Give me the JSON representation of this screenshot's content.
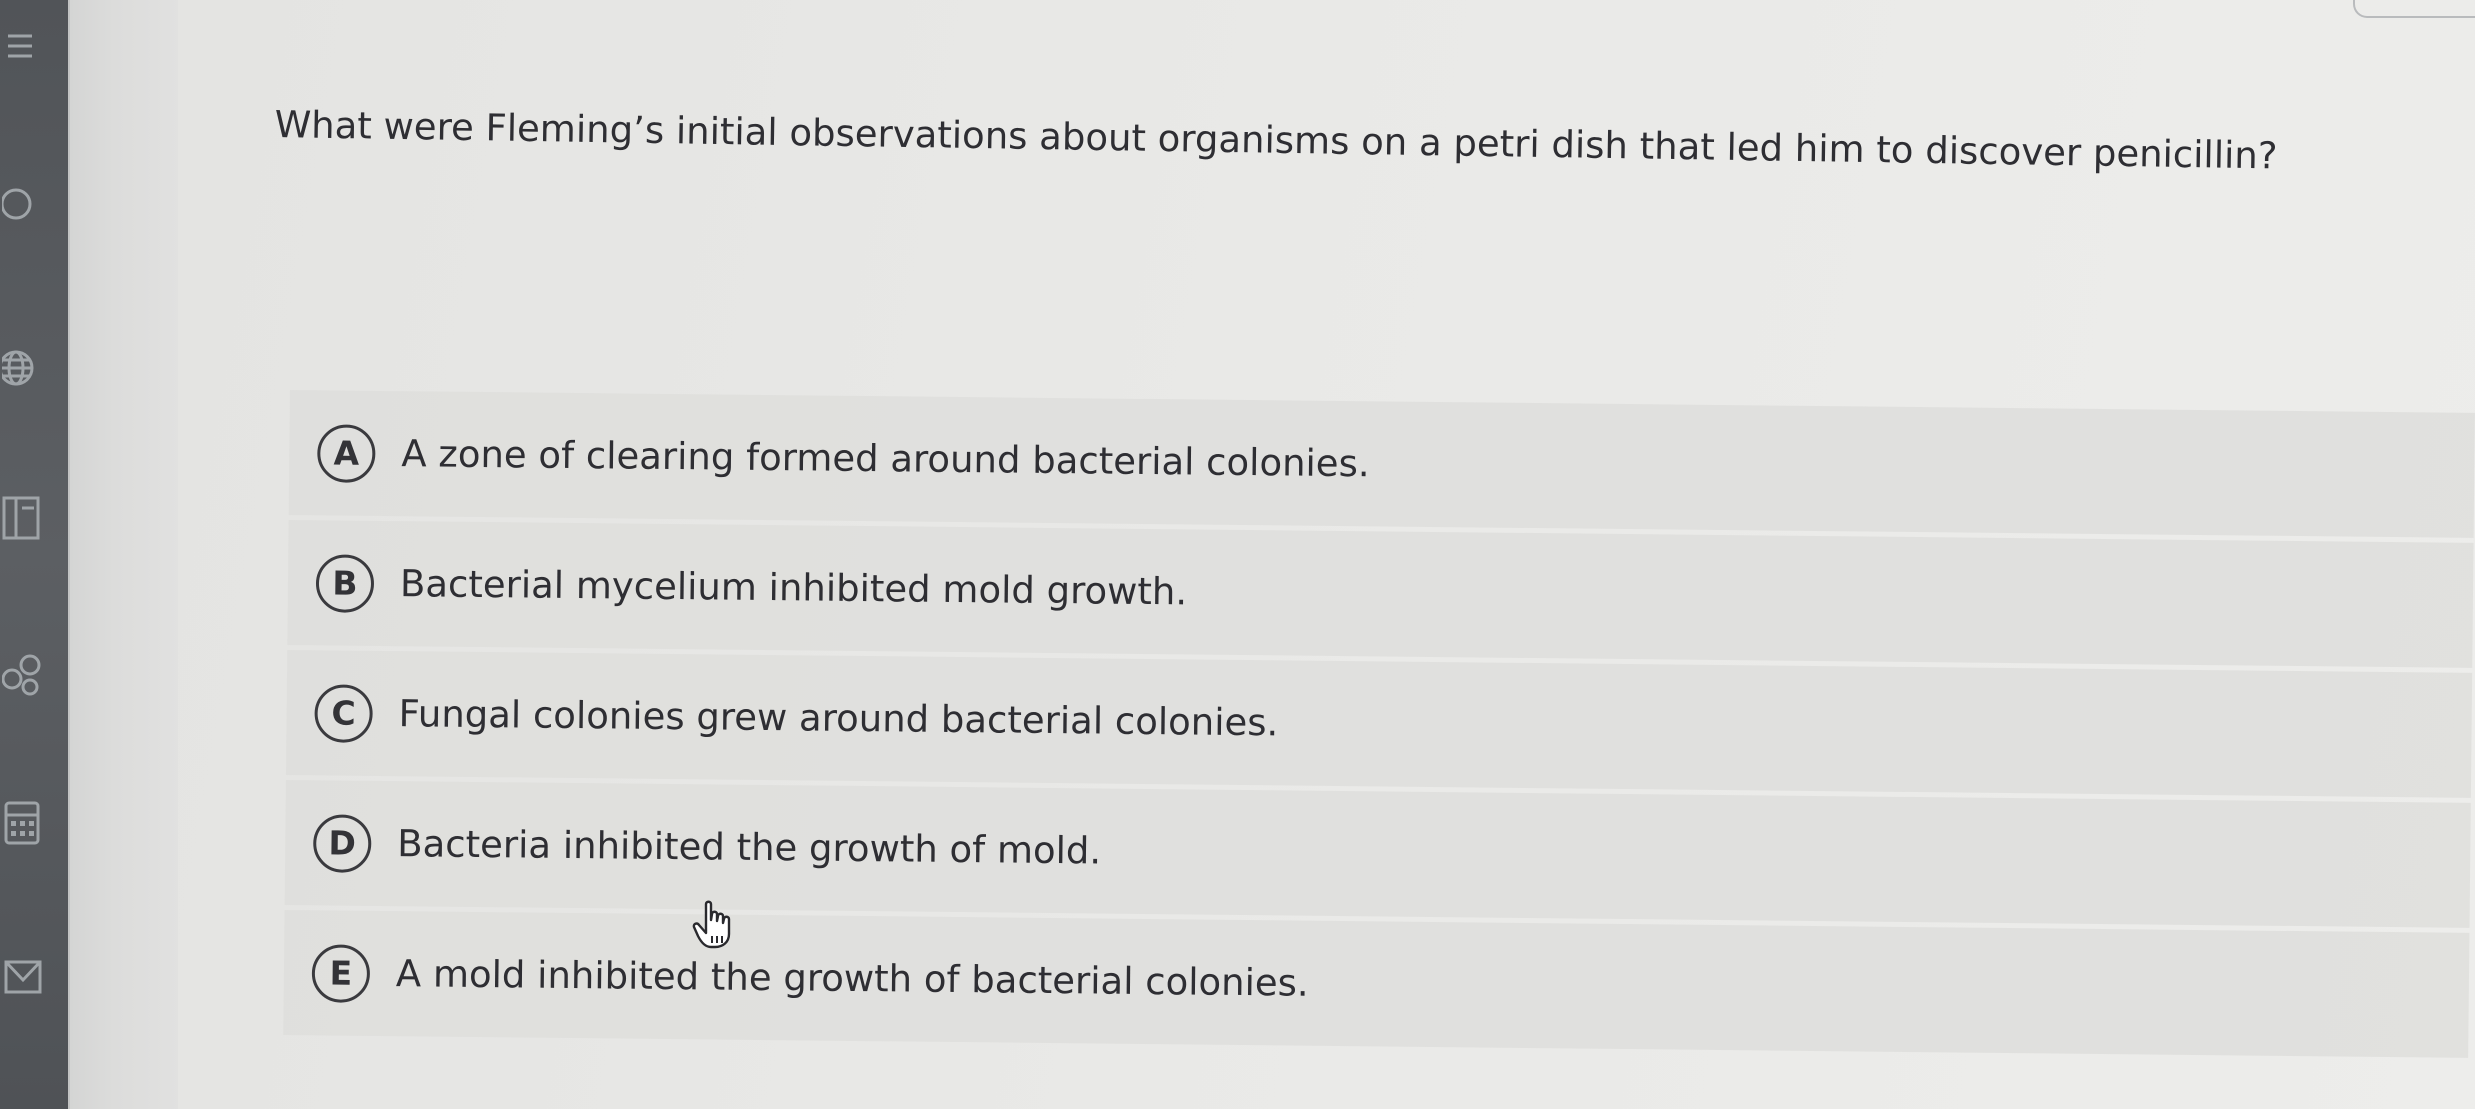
{
  "question": {
    "text": "What were Fleming’s initial observations about organisms on a petri dish that led him to discover penicillin?"
  },
  "options": [
    {
      "letter": "A",
      "text": "A zone of clearing formed around bacterial colonies."
    },
    {
      "letter": "B",
      "text": "Bacterial mycelium inhibited mold growth."
    },
    {
      "letter": "C",
      "text": "Fungal colonies grew around bacterial colonies."
    },
    {
      "letter": "D",
      "text": "Bacteria inhibited the growth of mold."
    },
    {
      "letter": "E",
      "text": "A mold inhibited the growth of bacterial colonies."
    }
  ],
  "sidebar": {
    "icons": [
      "menu-icon",
      "search-icon",
      "globe-icon",
      "layout-icon",
      "link-icon",
      "calculator-icon",
      "mail-icon"
    ]
  },
  "colors": {
    "sidebar": "#55585c",
    "background": "#e8e8e6",
    "option_background": "#dededc",
    "text": "#2e2e33"
  },
  "cursor": "hand-pointer-icon"
}
